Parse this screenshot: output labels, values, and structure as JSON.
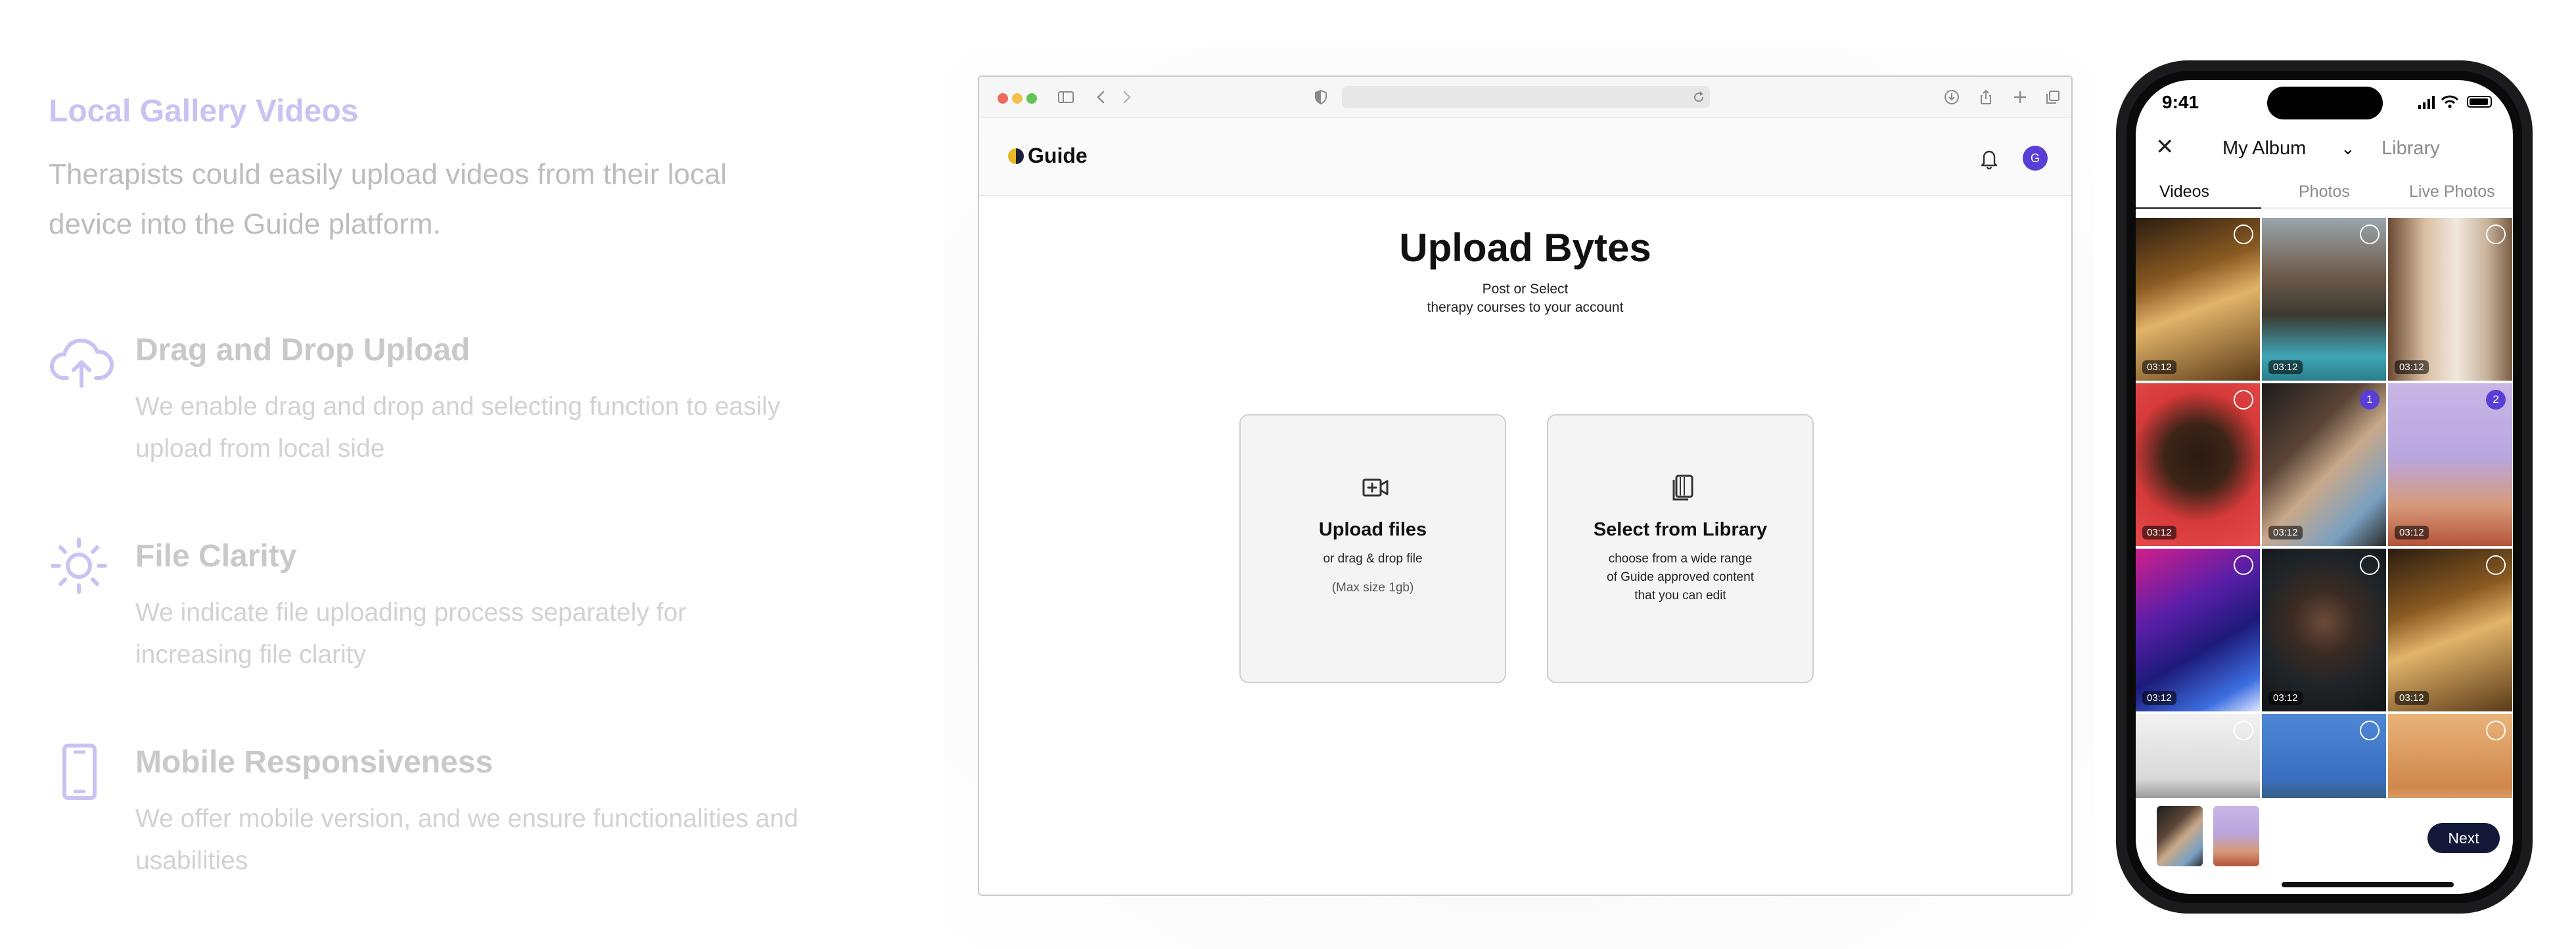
{
  "features": {
    "hero_title": "Local Gallery Videos",
    "hero_desc": "Therapists could easily upload videos from their local device into the Guide platform.",
    "items": [
      {
        "icon": "cloud-upload-icon",
        "title": "Drag and Drop Upload",
        "desc": "We enable drag and drop and selecting function to easily upload from local side"
      },
      {
        "icon": "sun-icon",
        "title": "File Clarity",
        "desc": "We indicate file uploading process separately for increasing file clarity"
      },
      {
        "icon": "mobile-phone-icon",
        "title": "Mobile Responsiveness",
        "desc": "We offer mobile version, and we ensure functionalities and usabilities"
      }
    ],
    "accent_color": "#c8c3f2"
  },
  "browser": {
    "logo_text": "Guide",
    "avatar_initial": "G",
    "title": "Upload Bytes",
    "subtitle_line1": "Post or Select",
    "subtitle_line2": "therapy courses to your account",
    "cards": [
      {
        "icon": "video-plus-icon",
        "title": "Upload files",
        "line1": "or drag & drop file",
        "line2": "(Max size 1gb)"
      },
      {
        "icon": "library-icon",
        "title": "Select from Library",
        "line1": "choose from a wide range",
        "line2": "of Guide approved content",
        "line3": "that you can edit"
      }
    ]
  },
  "phone": {
    "time": "9:41",
    "album_label": "My Album",
    "library_label": "Library",
    "tabs": [
      "Videos",
      "Photos",
      "Live Photos"
    ],
    "active_tab": "Videos",
    "tiles": [
      {
        "duration": "03:12",
        "selected_index": ""
      },
      {
        "duration": "03:12",
        "selected_index": ""
      },
      {
        "duration": "03:12",
        "selected_index": ""
      },
      {
        "duration": "03:12",
        "selected_index": ""
      },
      {
        "duration": "03:12",
        "selected_index": "1"
      },
      {
        "duration": "03:12",
        "selected_index": "2"
      },
      {
        "duration": "03:12",
        "selected_index": ""
      },
      {
        "duration": "03:12",
        "selected_index": ""
      },
      {
        "duration": "03:12",
        "selected_index": ""
      },
      {
        "duration": "",
        "selected_index": ""
      },
      {
        "duration": "",
        "selected_index": ""
      },
      {
        "duration": "",
        "selected_index": ""
      }
    ],
    "next_label": "Next",
    "selection_color": "#5a3fd6"
  }
}
